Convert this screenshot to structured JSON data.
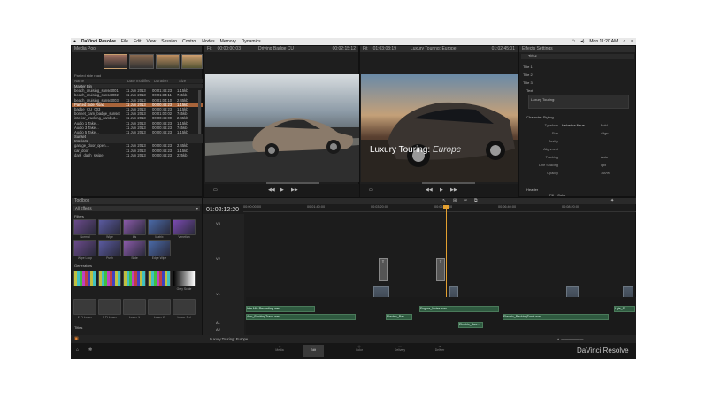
{
  "menubar": {
    "apple": "",
    "items": [
      "DaVinci Resolve",
      "File",
      "Edit",
      "View",
      "Session",
      "Control",
      "Nodes",
      "Memory",
      "Dynamics"
    ],
    "clock": "Mon 11:20 AM"
  },
  "media_pool": {
    "title": "Media Pool",
    "clip_label": "Parked side road",
    "columns": [
      "Name",
      "Date modified",
      "Duration",
      "Size"
    ],
    "rows": [
      {
        "type": "bin",
        "name": "Master Bin"
      },
      {
        "name": "beach_cruising_sunset001",
        "date": "11 Jun 2013",
        "dur": "00:01:46:23",
        "size": "1.15kb"
      },
      {
        "name": "beach_cruising_sunset002",
        "date": "11 Jun 2013",
        "dur": "00:01:34:11",
        "size": "745kb"
      },
      {
        "name": "beach_cruising_sunset003",
        "date": "11 Jun 2013",
        "dur": "00:01:04:10",
        "size": "2.45kb"
      },
      {
        "name": "Parked Side Road",
        "date": "11 Jun 2013",
        "dur": "00:00:46:23",
        "size": "1.15kb",
        "sel": true
      },
      {
        "name": "badge_CU_003",
        "date": "11 Jun 2013",
        "dur": "00:00:46:23",
        "size": "1.15kb"
      },
      {
        "name": "bonnet_cam_badge_sunset",
        "date": "11 Jun 2013",
        "dur": "00:01:00:02",
        "size": "745kb"
      },
      {
        "name": "interior_tracking_cambut...",
        "date": "11 Jun 2013",
        "dur": "00:00:46:00",
        "size": "2.45kb"
      },
      {
        "name": "Audio 1 Take...",
        "date": "11 Jun 2013",
        "dur": "00:00:46:23",
        "size": "1.15kb"
      },
      {
        "name": "Audio 3 Take...",
        "date": "11 Jun 2013",
        "dur": "00:00:46:23",
        "size": "745kb"
      },
      {
        "name": "Audio 5 Take...",
        "date": "11 Jun 2013",
        "dur": "00:00:46:23",
        "size": "1.15kb"
      },
      {
        "type": "bin",
        "name": "Sunset"
      },
      {
        "type": "bin",
        "name": "Interiors"
      },
      {
        "name": "garage_door_open...",
        "date": "11 Jun 2013",
        "dur": "00:00:46:23",
        "size": "2.45kb"
      },
      {
        "name": "car_door",
        "date": "11 Jun 2013",
        "dur": "00:00:46:23",
        "size": "1.15kb"
      },
      {
        "name": "dark_dash_swipe",
        "date": "11 Jun 2013",
        "dur": "00:00:46:23",
        "size": "225kb"
      }
    ]
  },
  "source_viewer": {
    "fit": "Fit",
    "tc_in": "00:00:00:03",
    "clip": "Driving Badge CU",
    "tc_out": "00:02:15:12"
  },
  "timeline_viewer": {
    "fit": "Fit",
    "tc_in": "01:03:08:19",
    "timeline": "Luxury Touring: Europe",
    "tc_out": "01:02:45:01"
  },
  "overlay_title": {
    "main": "Luxury Touring:",
    "accent": "Europe"
  },
  "effects_settings": {
    "title": "Effects Settings",
    "tab": "Titles",
    "items": [
      "Title 1",
      "Title 2",
      "Title 3"
    ],
    "text_section": "Text",
    "text_value": "Luxury Touring:",
    "styling": "Character Styling",
    "params": [
      {
        "label": "Typeface",
        "value": "Helvetica Neue",
        "extra": "Bold"
      },
      {
        "label": "Size",
        "value": "",
        "extra": "Align"
      },
      {
        "label": "Justify",
        "value": "",
        "extra": ""
      },
      {
        "label": "Alignment",
        "value": "",
        "extra": ""
      },
      {
        "label": "Tracking",
        "value": "",
        "extra": "Auto"
      },
      {
        "label": "Line Spacing",
        "value": "",
        "extra": "0px"
      },
      {
        "label": "Opacity",
        "value": "",
        "extra": "100%"
      }
    ],
    "header": "Header",
    "fill_label": "Fill",
    "fill_value": "Color"
  },
  "toolbox": {
    "title": "Toolbox",
    "category": "All Effects",
    "filters_title": "Filters",
    "filters": [
      "Normal",
      "Wipe",
      "Iris",
      "Matrix",
      "Venetian",
      "Wipe Loop",
      "Push",
      "Slide",
      "Edge Wipe"
    ],
    "generators_title": "Generators",
    "generators": [
      "",
      "",
      "",
      "",
      "Grey Scale"
    ],
    "titles_row": [
      "2 Pt Lower",
      "3 Pt Lower",
      "Lower 1",
      "Lower 2",
      "Lower 3rd"
    ],
    "titles_title": "Titles"
  },
  "timeline": {
    "timecode": "01:02:12:20",
    "ruler": [
      "00:00:00:00",
      "00:01:40:00",
      "00:03:20:00",
      "00:05:00:00",
      "00:06:40:00",
      "00:08:20:00"
    ],
    "tracks": [
      "V3",
      "V2",
      "V1",
      "A1",
      "A2",
      "A3"
    ],
    "video_clips": [
      "Parked_Int_02",
      "Parked_Front...",
      "Interio...",
      "Interi...",
      "Rim_shot...",
      "Interio...",
      "Sunset cruising car",
      "Garage_O2",
      "Driving_Sunset...",
      "Inte..."
    ],
    "audio_clips": [
      "Inte Mic Recording.wav",
      "Ann_BackingTrack.wav",
      "Engine_Noise.wav",
      "Electric_Bas...",
      "Electric_Bas...",
      "Electric_BackingTrack.wav",
      "Lyte_Si..."
    ],
    "footer_name": "Luxury Touring: Europe"
  },
  "pages": [
    "Media",
    "Edit",
    "Color",
    "Delivery",
    "Deliver"
  ],
  "active_page": "Edit",
  "brand": "DaVinci Resolve"
}
